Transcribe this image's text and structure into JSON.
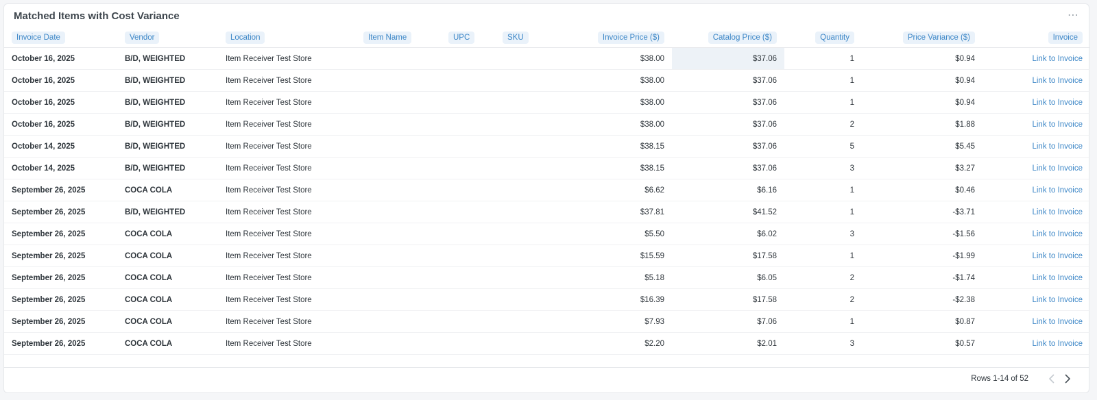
{
  "card": {
    "title": "Matched Items with Cost Variance",
    "more_icon": "⋯"
  },
  "columns": [
    {
      "label": "Invoice Date"
    },
    {
      "label": "Vendor"
    },
    {
      "label": "Location"
    },
    {
      "label": "Item Name"
    },
    {
      "label": "UPC"
    },
    {
      "label": "SKU"
    },
    {
      "label": "Invoice Price ($)"
    },
    {
      "label": "Catalog Price ($)"
    },
    {
      "label": "Quantity"
    },
    {
      "label": "Price Variance ($)"
    },
    {
      "label": "Invoice"
    }
  ],
  "rows": [
    {
      "date": "October 16, 2025",
      "vendor": "B/D, WEIGHTED",
      "location": "Item Receiver Test Store",
      "item": "",
      "upc": "",
      "sku": "",
      "invoice_price": "$38.00",
      "catalog_price": "$37.06",
      "quantity": "1",
      "variance": "$0.94",
      "link": "Link to Invoice"
    },
    {
      "date": "October 16, 2025",
      "vendor": "B/D, WEIGHTED",
      "location": "Item Receiver Test Store",
      "item": "",
      "upc": "",
      "sku": "",
      "invoice_price": "$38.00",
      "catalog_price": "$37.06",
      "quantity": "1",
      "variance": "$0.94",
      "link": "Link to Invoice"
    },
    {
      "date": "October 16, 2025",
      "vendor": "B/D, WEIGHTED",
      "location": "Item Receiver Test Store",
      "item": "",
      "upc": "",
      "sku": "",
      "invoice_price": "$38.00",
      "catalog_price": "$37.06",
      "quantity": "1",
      "variance": "$0.94",
      "link": "Link to Invoice"
    },
    {
      "date": "October 16, 2025",
      "vendor": "B/D, WEIGHTED",
      "location": "Item Receiver Test Store",
      "item": "",
      "upc": "",
      "sku": "",
      "invoice_price": "$38.00",
      "catalog_price": "$37.06",
      "quantity": "2",
      "variance": "$1.88",
      "link": "Link to Invoice"
    },
    {
      "date": "October 14, 2025",
      "vendor": "B/D, WEIGHTED",
      "location": "Item Receiver Test Store",
      "item": "",
      "upc": "",
      "sku": "",
      "invoice_price": "$38.15",
      "catalog_price": "$37.06",
      "quantity": "5",
      "variance": "$5.45",
      "link": "Link to Invoice"
    },
    {
      "date": "October 14, 2025",
      "vendor": "B/D, WEIGHTED",
      "location": "Item Receiver Test Store",
      "item": "",
      "upc": "",
      "sku": "",
      "invoice_price": "$38.15",
      "catalog_price": "$37.06",
      "quantity": "3",
      "variance": "$3.27",
      "link": "Link to Invoice"
    },
    {
      "date": "September 26, 2025",
      "vendor": "COCA COLA",
      "location": "Item Receiver Test Store",
      "item": "",
      "upc": "",
      "sku": "",
      "invoice_price": "$6.62",
      "catalog_price": "$6.16",
      "quantity": "1",
      "variance": "$0.46",
      "link": "Link to Invoice"
    },
    {
      "date": "September 26, 2025",
      "vendor": "B/D, WEIGHTED",
      "location": "Item Receiver Test Store",
      "item": "",
      "upc": "",
      "sku": "",
      "invoice_price": "$37.81",
      "catalog_price": "$41.52",
      "quantity": "1",
      "variance": "-$3.71",
      "link": "Link to Invoice"
    },
    {
      "date": "September 26, 2025",
      "vendor": "COCA COLA",
      "location": "Item Receiver Test Store",
      "item": "",
      "upc": "",
      "sku": "",
      "invoice_price": "$5.50",
      "catalog_price": "$6.02",
      "quantity": "3",
      "variance": "-$1.56",
      "link": "Link to Invoice"
    },
    {
      "date": "September 26, 2025",
      "vendor": "COCA COLA",
      "location": "Item Receiver Test Store",
      "item": "",
      "upc": "",
      "sku": "",
      "invoice_price": "$15.59",
      "catalog_price": "$17.58",
      "quantity": "1",
      "variance": "-$1.99",
      "link": "Link to Invoice"
    },
    {
      "date": "September 26, 2025",
      "vendor": "COCA COLA",
      "location": "Item Receiver Test Store",
      "item": "",
      "upc": "",
      "sku": "",
      "invoice_price": "$5.18",
      "catalog_price": "$6.05",
      "quantity": "2",
      "variance": "-$1.74",
      "link": "Link to Invoice"
    },
    {
      "date": "September 26, 2025",
      "vendor": "COCA COLA",
      "location": "Item Receiver Test Store",
      "item": "",
      "upc": "",
      "sku": "",
      "invoice_price": "$16.39",
      "catalog_price": "$17.58",
      "quantity": "2",
      "variance": "-$2.38",
      "link": "Link to Invoice"
    },
    {
      "date": "September 26, 2025",
      "vendor": "COCA COLA",
      "location": "Item Receiver Test Store",
      "item": "",
      "upc": "",
      "sku": "",
      "invoice_price": "$7.93",
      "catalog_price": "$7.06",
      "quantity": "1",
      "variance": "$0.87",
      "link": "Link to Invoice"
    },
    {
      "date": "September 26, 2025",
      "vendor": "COCA COLA",
      "location": "Item Receiver Test Store",
      "item": "",
      "upc": "",
      "sku": "",
      "invoice_price": "$2.20",
      "catalog_price": "$2.01",
      "quantity": "3",
      "variance": "$0.57",
      "link": "Link to Invoice"
    }
  ],
  "footer": {
    "rows_label": "Rows 1-14 of 52",
    "prev_icon": "chevron-left-icon",
    "next_icon": "chevron-right-icon"
  },
  "colors": {
    "accent": "#3d87c7",
    "header_pill_bg": "#eaf2fa",
    "highlight_cell": "#edf2f7"
  }
}
